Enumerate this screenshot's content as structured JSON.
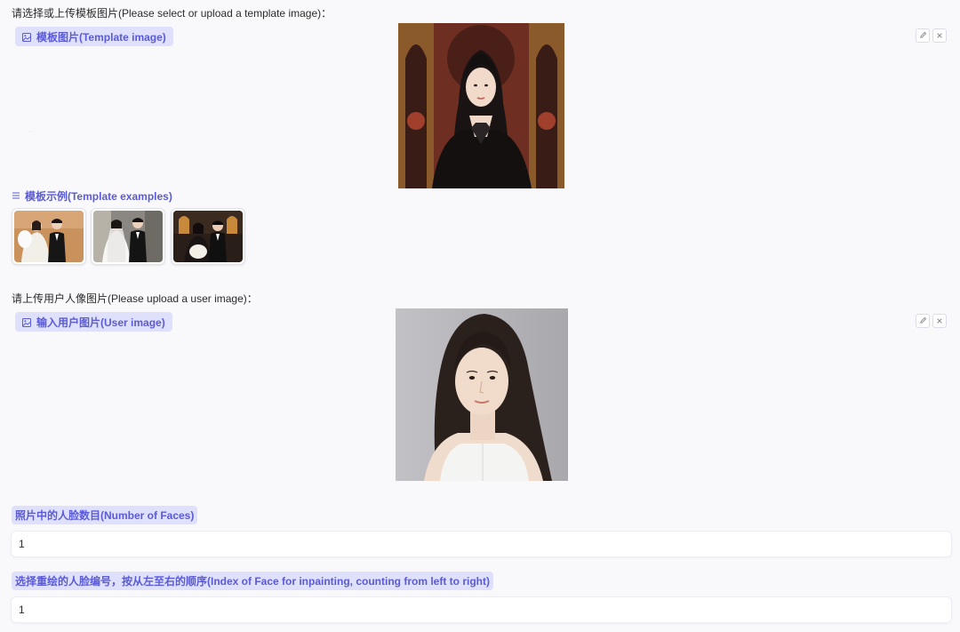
{
  "template_section": {
    "prompt": "请选择或上传模板图片(Please select or upload a template image)：",
    "chip_label": "模板图片(Template image)",
    "image_icon": "image-icon",
    "edit_icon": "pencil-icon",
    "clear_icon": "close-icon"
  },
  "examples_section": {
    "label": "模板示例(Template examples)",
    "list_icon": "list-icon",
    "thumbnails": [
      "wedding-couple-lace-fan",
      "wedding-couple-white-veil",
      "wedding-couple-dark-hall"
    ]
  },
  "user_section": {
    "prompt": "请上传用户人像图片(Please upload a user image)：",
    "chip_label": "输入用户图片(User image)",
    "image_icon": "image-icon",
    "edit_icon": "pencil-icon",
    "clear_icon": "close-icon"
  },
  "faces_field": {
    "label": "照片中的人脸数目(Number of Faces)",
    "value": "1"
  },
  "index_field": {
    "label": "选择重绘的人脸编号，按从左至右的顺序(Index of Face for inpainting, counting from left to right)",
    "value": "1"
  },
  "colors": {
    "background": "#f9f9fc",
    "chip_bg": "#dfe0fb",
    "accent": "#5b5bd6"
  }
}
